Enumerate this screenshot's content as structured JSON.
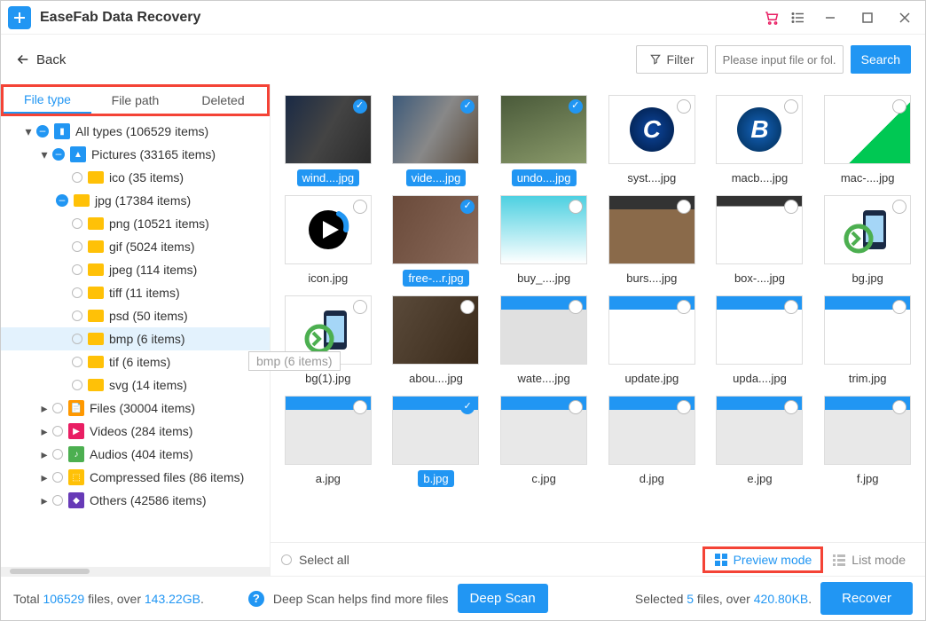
{
  "app": {
    "title": "EaseFab Data Recovery"
  },
  "toolbar": {
    "back": "Back",
    "filter": "Filter",
    "search_placeholder": "Please input file or fol...",
    "search": "Search"
  },
  "tabs": {
    "file_type": "File type",
    "file_path": "File path",
    "deleted": "Deleted"
  },
  "tree": {
    "all": "All types (106529 items)",
    "pictures": "Pictures (33165 items)",
    "ico": "ico (35 items)",
    "jpg": "jpg (17384 items)",
    "png": "png (10521 items)",
    "gif": "gif (5024 items)",
    "jpeg": "jpeg (114 items)",
    "tiff": "tiff (11 items)",
    "psd": "psd (50 items)",
    "bmp": "bmp (6 items)",
    "tif": "tif (6 items)",
    "svg": "svg (14 items)",
    "files": "Files (30004 items)",
    "videos": "Videos (284 items)",
    "audios": "Audios (404 items)",
    "compressed": "Compressed files (86 items)",
    "others": "Others (42586 items)"
  },
  "tooltip": "bmp (6 items)",
  "files": [
    {
      "name": "wind....jpg",
      "sel": true,
      "bg": "linear-gradient(120deg,#1a2a45,#444,#2b2b2b)"
    },
    {
      "name": "vide....jpg",
      "sel": true,
      "bg": "linear-gradient(120deg,#3d5a7a,#888,#5a4a3a)"
    },
    {
      "name": "undo....jpg",
      "sel": true,
      "bg": "linear-gradient(160deg,#4a5a3a,#8a9a6a)"
    },
    {
      "name": "syst....jpg",
      "sel": false,
      "bg": "radial-gradient(circle,#0d47a1,#001a40)",
      "letter": "C"
    },
    {
      "name": "macb....jpg",
      "sel": false,
      "bg": "radial-gradient(circle,#1565c0,#002a50)",
      "letter": "B"
    },
    {
      "name": "mac-....jpg",
      "sel": false,
      "bg": "linear-gradient(135deg,#fff 60%,#00c853 60%)"
    },
    {
      "name": "icon.jpg",
      "sel": false,
      "bg": "#fff",
      "icon": "play"
    },
    {
      "name": "free-...r.jpg",
      "sel": true,
      "bg": "linear-gradient(120deg,#6a4a3a,#8a6a5a)"
    },
    {
      "name": "buy_....jpg",
      "sel": false,
      "bg": "linear-gradient(180deg,#4dd0e1,#fff)"
    },
    {
      "name": "burs....jpg",
      "sel": false,
      "bg": "linear-gradient(180deg,#333 20%,#8a6a4a 20%)"
    },
    {
      "name": "box-....jpg",
      "sel": false,
      "bg": "linear-gradient(180deg,#333 15%,#fff 15%)"
    },
    {
      "name": "bg.jpg",
      "sel": false,
      "bg": "#fff",
      "icon": "phone"
    },
    {
      "name": "bg(1).jpg",
      "sel": false,
      "bg": "#fff",
      "icon": "phone"
    },
    {
      "name": "abou....jpg",
      "sel": false,
      "bg": "linear-gradient(120deg,#5a4a3a,#3a2a1a)"
    },
    {
      "name": "wate....jpg",
      "sel": false,
      "bg": "linear-gradient(180deg,#2196f3 20%,#e0e0e0 20%)"
    },
    {
      "name": "update.jpg",
      "sel": false,
      "bg": "linear-gradient(180deg,#2196f3 20%,#fff 20%)"
    },
    {
      "name": "upda....jpg",
      "sel": false,
      "bg": "linear-gradient(180deg,#2196f3 20%,#fff 20%)"
    },
    {
      "name": "trim.jpg",
      "sel": false,
      "bg": "linear-gradient(180deg,#2196f3 20%,#fff 20%)"
    },
    {
      "name": "a.jpg",
      "sel": false,
      "bg": "linear-gradient(180deg,#2196f3 20%,#e8e8e8 20%)"
    },
    {
      "name": "b.jpg",
      "sel": true,
      "bg": "linear-gradient(180deg,#2196f3 20%,#e8e8e8 20%)"
    },
    {
      "name": "c.jpg",
      "sel": false,
      "bg": "linear-gradient(180deg,#2196f3 20%,#e8e8e8 20%)"
    },
    {
      "name": "d.jpg",
      "sel": false,
      "bg": "linear-gradient(180deg,#2196f3 20%,#e8e8e8 20%)"
    },
    {
      "name": "e.jpg",
      "sel": false,
      "bg": "linear-gradient(180deg,#2196f3 20%,#e8e8e8 20%)"
    },
    {
      "name": "f.jpg",
      "sel": false,
      "bg": "linear-gradient(180deg,#2196f3 20%,#e8e8e8 20%)"
    }
  ],
  "viewbar": {
    "select_all": "Select all",
    "preview": "Preview mode",
    "list": "List mode"
  },
  "footer": {
    "total_pre": "Total ",
    "total_files": "106529",
    "total_mid": " files, over ",
    "total_size": "143.22GB",
    "total_end": ".",
    "deepscan_hint": "Deep Scan helps find more files",
    "deepscan": "Deep Scan",
    "sel_pre": "Selected ",
    "sel_files": "5",
    "sel_mid": " files, over ",
    "sel_size": "420.80KB",
    "sel_end": ".",
    "recover": "Recover"
  },
  "colors": {
    "accent": "#2196F3",
    "highlight": "#F44336"
  }
}
